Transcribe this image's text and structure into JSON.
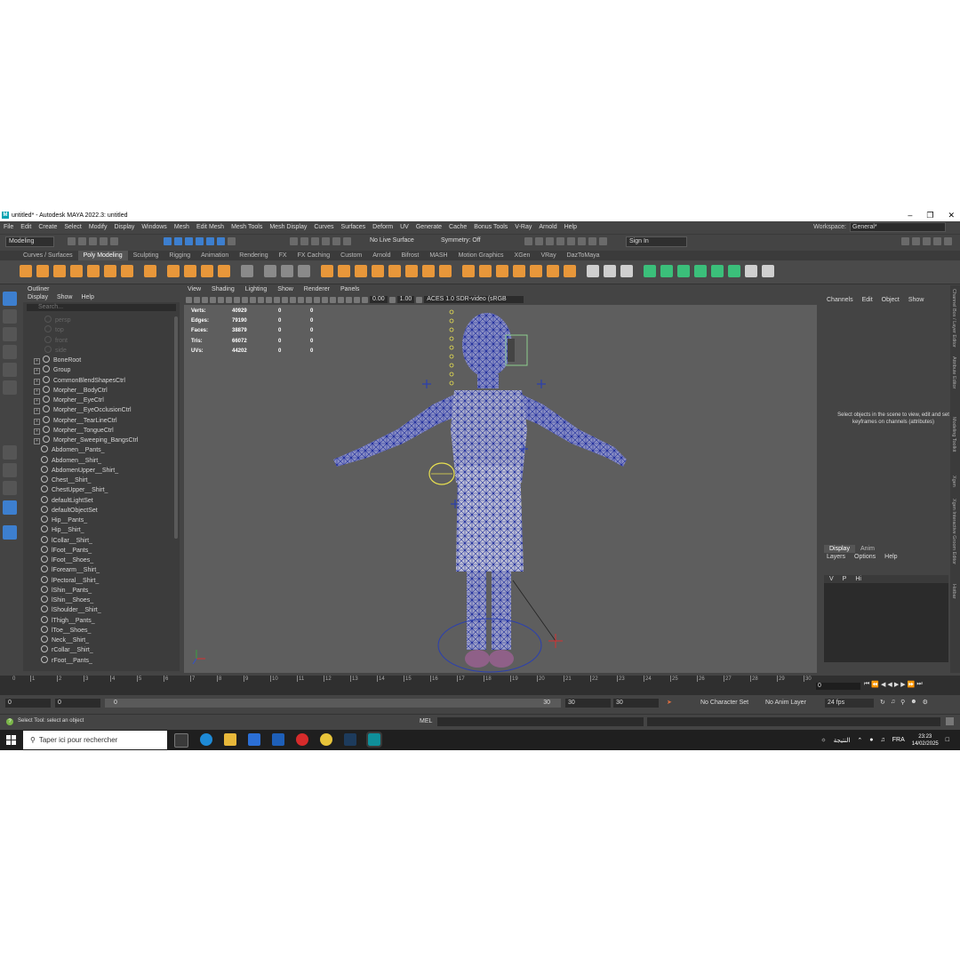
{
  "window": {
    "title": "untitled* - Autodesk MAYA 2022.3: untitled",
    "logo": "M"
  },
  "menus": [
    "File",
    "Edit",
    "Create",
    "Select",
    "Modify",
    "Display",
    "Windows",
    "Mesh",
    "Edit Mesh",
    "Mesh Tools",
    "Mesh Display",
    "Curves",
    "Surfaces",
    "Deform",
    "UV",
    "Generate",
    "Cache",
    "Bonus Tools",
    "V-Ray",
    "Arnold",
    "Help"
  ],
  "workspace": {
    "label": "Workspace:",
    "value": "General*"
  },
  "statusline": {
    "mode": "Modeling",
    "live_surface": "No Live Surface",
    "symmetry": "Symmetry: Off",
    "sign_in": "Sign In"
  },
  "shelf_tabs": [
    "Curves / Surfaces",
    "Poly Modeling",
    "Sculpting",
    "Rigging",
    "Animation",
    "Rendering",
    "FX",
    "FX Caching",
    "Custom",
    "Arnold",
    "Bifrost",
    "MASH",
    "Motion Graphics",
    "XGen",
    "VRay",
    "DazToMaya"
  ],
  "shelf_active": "Poly Modeling",
  "outliner": {
    "title": "Outliner",
    "menu": [
      "Display",
      "Show",
      "Help"
    ],
    "search_placeholder": "Search...",
    "cameras": [
      "persp",
      "top",
      "front",
      "side"
    ],
    "groups": [
      "BoneRoot",
      "Group",
      "CommonBlendShapesCtrl",
      "Morpher__BodyCtrl",
      "Morpher__EyeCtrl",
      "Morpher__EyeOcclusionCtrl",
      "Morpher__TearLineCtrl",
      "Morpher__TongueCtrl",
      "Morpher_Sweeping_BangsCtrl"
    ],
    "items": [
      "Abdomen__Pants_",
      "Abdomen__Shirt_",
      "AbdomenUpper__Shirt_",
      "Chest__Shirt_",
      "ChestUpper__Shirt_",
      "defaultLightSet",
      "defaultObjectSet",
      "Hip__Pants_",
      "Hip__Shirt_",
      "lCollar__Shirt_",
      "lFoot__Pants_",
      "lFoot__Shoes_",
      "lForearm__Shirt_",
      "lPectoral__Shirt_",
      "lShin__Pants_",
      "lShin__Shoes_",
      "lShoulder__Shirt_",
      "lThigh__Pants_",
      "lToe__Shoes_",
      "Neck__Shirt_",
      "rCollar__Shirt_",
      "rFoot__Pants_"
    ]
  },
  "viewport": {
    "menu": [
      "View",
      "Shading",
      "Lighting",
      "Show",
      "Renderer",
      "Panels"
    ],
    "exposure": "0.00",
    "gamma": "1.00",
    "colorspace": "ACES 1.0 SDR-video (sRGB",
    "hud": [
      {
        "label": "Verts:",
        "value": "40929",
        "sel": "0",
        "comp": "0"
      },
      {
        "label": "Edges:",
        "value": "79190",
        "sel": "0",
        "comp": "0"
      },
      {
        "label": "Faces:",
        "value": "38879",
        "sel": "0",
        "comp": "0"
      },
      {
        "label": "Tris:",
        "value": "66072",
        "sel": "0",
        "comp": "0"
      },
      {
        "label": "UVs:",
        "value": "44202",
        "sel": "0",
        "comp": "0"
      }
    ]
  },
  "channelbox": {
    "menu": [
      "Channels",
      "Edit",
      "Object",
      "Show"
    ],
    "message": "Select objects in the scene to view, edit and set keyframes on channels (attributes)",
    "vertical_tabs": [
      "Channel Box / Layer Editor",
      "Attribute Editor",
      "Modeling Toolkit",
      "Xgen",
      "Xgen Interactive Groom Editor",
      "Hotbar"
    ]
  },
  "layers": {
    "tabs": [
      "Display",
      "Anim"
    ],
    "menu": [
      "Layers",
      "Options",
      "Help"
    ],
    "row": {
      "v": "V",
      "p": "P",
      "name": "Hi"
    }
  },
  "timeline": {
    "ticks": [
      "1",
      "2",
      "3",
      "4",
      "5",
      "6",
      "7",
      "8",
      "9",
      "10",
      "11",
      "12",
      "13",
      "14",
      "15",
      "16",
      "17",
      "18",
      "19",
      "20",
      "21",
      "22",
      "23",
      "24",
      "25",
      "26",
      "27",
      "28",
      "29",
      "30"
    ],
    "current_frame": "0",
    "current": "0"
  },
  "range": {
    "start": "0",
    "inner_start": "0",
    "bar_start": "0",
    "bar_end": "30",
    "end": "30",
    "outer_end": "30",
    "character_set": "No Character Set",
    "anim_layer": "No Anim Layer",
    "fps": "24 fps"
  },
  "cmdline": {
    "lang": "MEL",
    "help": "Select Tool: select an object"
  },
  "taskbar": {
    "search": "Taper ici pour rechercher",
    "tray_text": "النتيجة",
    "lang": "FRA",
    "time": "23:23",
    "date": "14/02/2025"
  }
}
